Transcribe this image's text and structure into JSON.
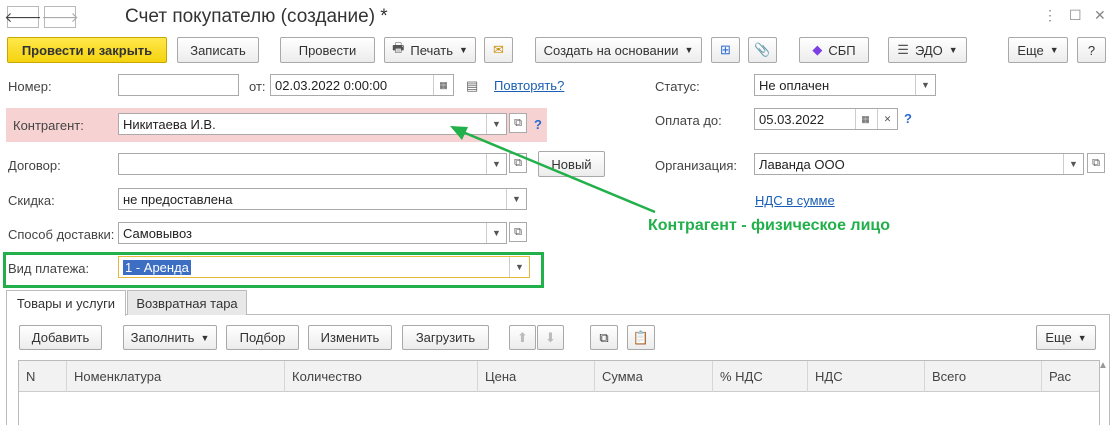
{
  "window": {
    "title": "Счет покупателю (создание) *",
    "back": "🡐",
    "forward": "🡒",
    "more_icon": "more-vertical-icon",
    "maximize_icon": "maximize-icon",
    "close_icon": "close-icon"
  },
  "toolbar": {
    "post_close": "Провести и закрыть",
    "save": "Записать",
    "post": "Провести",
    "print": "Печать",
    "create_based": "Создать на основании",
    "sbp": "СБП",
    "edo": "ЭДО",
    "more": "Еще",
    "help": "?"
  },
  "form": {
    "number_label": "Номер:",
    "number_value": "",
    "from_label": "от:",
    "date_value": "02.03.2022  0:00:00",
    "repeat_link": "Повторять?",
    "status_label": "Статус:",
    "status_value": "Не оплачен",
    "counterparty_label": "Контрагент:",
    "counterparty_value": "Никитаева И.В.",
    "pay_until_label": "Оплата до:",
    "pay_until_value": "05.03.2022",
    "contract_label": "Договор:",
    "contract_value": "",
    "new_button": "Новый",
    "org_label": "Организация:",
    "org_value": "Лаванда ООО",
    "vat_link": "НДС в сумме",
    "discount_label": "Скидка:",
    "discount_value": "не предоставлена",
    "delivery_label": "Способ доставки:",
    "delivery_value": "Самовывоз",
    "payment_type_label": "Вид платежа:",
    "payment_type_value": "1 - Аренда",
    "help_q": "?"
  },
  "annotation": {
    "text": "Контрагент - физическое лицо",
    "color": "#22b04a"
  },
  "tabs": [
    {
      "label": "Товары и услуги",
      "active": true
    },
    {
      "label": "Возвратная тара",
      "active": false
    }
  ],
  "table_toolbar": {
    "add": "Добавить",
    "fill": "Заполнить",
    "pick": "Подбор",
    "edit": "Изменить",
    "load": "Загрузить",
    "more": "Еще"
  },
  "table": {
    "columns": [
      "N",
      "Номенклатура",
      "Количество",
      "Цена",
      "Сумма",
      "% НДС",
      "НДС",
      "Всего",
      "Рас"
    ]
  },
  "colors": {
    "primary_button": "#f5d30f",
    "highlight_pink": "#f6d2d2",
    "link": "#1a5fb4"
  }
}
